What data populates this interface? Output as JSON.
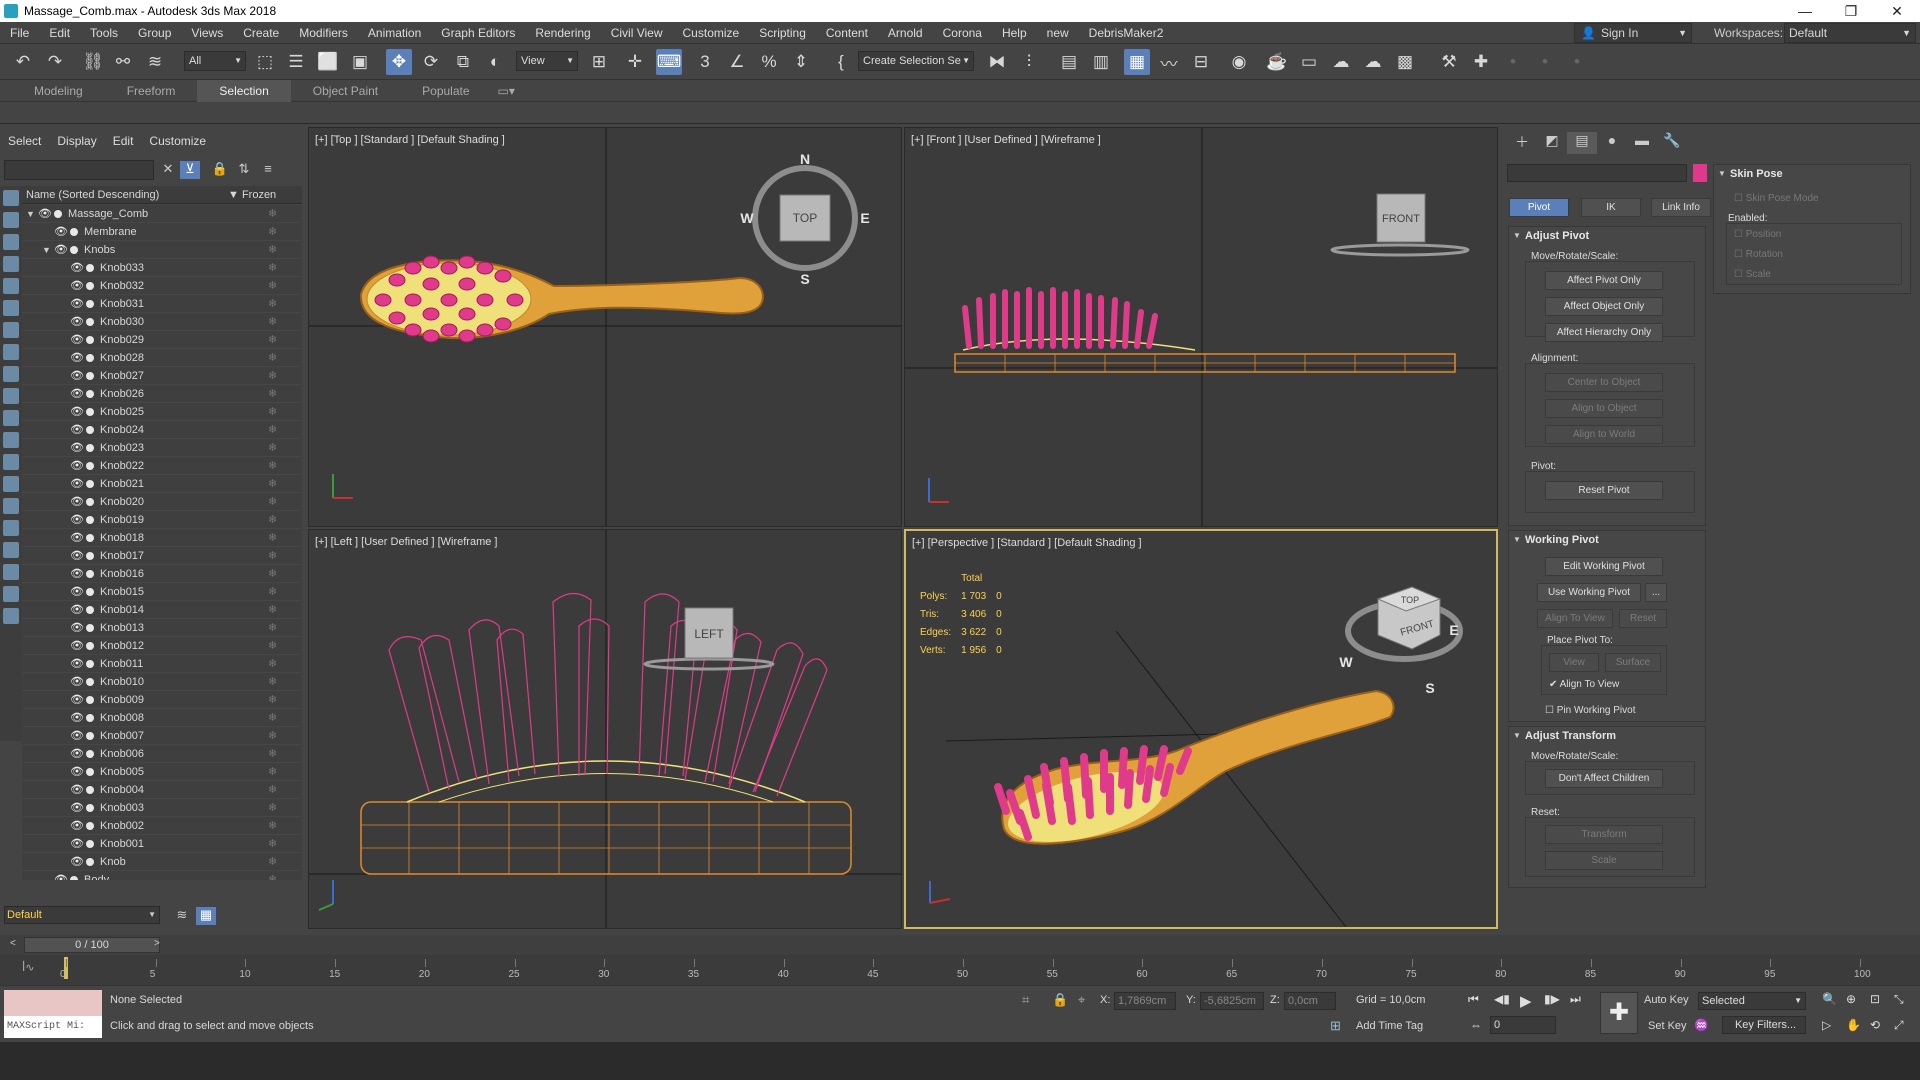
{
  "window": {
    "title": "Massage_Comb.max - Autodesk 3ds Max 2018",
    "minimize": "—",
    "maximize": "❐",
    "close": "✕"
  },
  "menu": [
    "File",
    "Edit",
    "Tools",
    "Group",
    "Views",
    "Create",
    "Modifiers",
    "Animation",
    "Graph Editors",
    "Rendering",
    "Civil View",
    "Customize",
    "Scripting",
    "Content",
    "Arnold",
    "Corona",
    "Help",
    "new",
    "DebrisMaker2"
  ],
  "signin": "Sign In",
  "workspace": {
    "label": "Workspaces:",
    "value": "Default"
  },
  "toolbar": {
    "filter": "All",
    "ref_coord": "View",
    "selection_set": "Create Selection Se"
  },
  "ribbon": {
    "tabs": [
      "Modeling",
      "Freeform",
      "Selection",
      "Object Paint",
      "Populate"
    ],
    "active": "Selection"
  },
  "explorer": {
    "menu": [
      "Select",
      "Display",
      "Edit",
      "Customize"
    ],
    "col_name": "Name (Sorted Descending)",
    "col_frozen": "▼ Frozen",
    "layer": "Default",
    "items": [
      {
        "name": "Massage_Comb",
        "level": 0,
        "toggle": "▼"
      },
      {
        "name": "Membrane",
        "level": 1,
        "toggle": ""
      },
      {
        "name": "Knobs",
        "level": 1,
        "toggle": "▼"
      },
      {
        "name": "Knob033",
        "level": 2,
        "toggle": ""
      },
      {
        "name": "Knob032",
        "level": 2,
        "toggle": ""
      },
      {
        "name": "Knob031",
        "level": 2,
        "toggle": ""
      },
      {
        "name": "Knob030",
        "level": 2,
        "toggle": ""
      },
      {
        "name": "Knob029",
        "level": 2,
        "toggle": ""
      },
      {
        "name": "Knob028",
        "level": 2,
        "toggle": ""
      },
      {
        "name": "Knob027",
        "level": 2,
        "toggle": ""
      },
      {
        "name": "Knob026",
        "level": 2,
        "toggle": ""
      },
      {
        "name": "Knob025",
        "level": 2,
        "toggle": ""
      },
      {
        "name": "Knob024",
        "level": 2,
        "toggle": ""
      },
      {
        "name": "Knob023",
        "level": 2,
        "toggle": ""
      },
      {
        "name": "Knob022",
        "level": 2,
        "toggle": ""
      },
      {
        "name": "Knob021",
        "level": 2,
        "toggle": ""
      },
      {
        "name": "Knob020",
        "level": 2,
        "toggle": ""
      },
      {
        "name": "Knob019",
        "level": 2,
        "toggle": ""
      },
      {
        "name": "Knob018",
        "level": 2,
        "toggle": ""
      },
      {
        "name": "Knob017",
        "level": 2,
        "toggle": ""
      },
      {
        "name": "Knob016",
        "level": 2,
        "toggle": ""
      },
      {
        "name": "Knob015",
        "level": 2,
        "toggle": ""
      },
      {
        "name": "Knob014",
        "level": 2,
        "toggle": ""
      },
      {
        "name": "Knob013",
        "level": 2,
        "toggle": ""
      },
      {
        "name": "Knob012",
        "level": 2,
        "toggle": ""
      },
      {
        "name": "Knob011",
        "level": 2,
        "toggle": ""
      },
      {
        "name": "Knob010",
        "level": 2,
        "toggle": ""
      },
      {
        "name": "Knob009",
        "level": 2,
        "toggle": ""
      },
      {
        "name": "Knob008",
        "level": 2,
        "toggle": ""
      },
      {
        "name": "Knob007",
        "level": 2,
        "toggle": ""
      },
      {
        "name": "Knob006",
        "level": 2,
        "toggle": ""
      },
      {
        "name": "Knob005",
        "level": 2,
        "toggle": ""
      },
      {
        "name": "Knob004",
        "level": 2,
        "toggle": ""
      },
      {
        "name": "Knob003",
        "level": 2,
        "toggle": ""
      },
      {
        "name": "Knob002",
        "level": 2,
        "toggle": ""
      },
      {
        "name": "Knob001",
        "level": 2,
        "toggle": ""
      },
      {
        "name": "Knob",
        "level": 2,
        "toggle": ""
      },
      {
        "name": "Body",
        "level": 1,
        "toggle": ""
      }
    ]
  },
  "viewports": {
    "top": {
      "label": "[+] [Top ] [Standard ] [Default Shading ]",
      "cube": "TOP",
      "compass": {
        "n": "N",
        "s": "S",
        "e": "E",
        "w": "W"
      }
    },
    "front": {
      "label": "[+] [Front ] [User Defined ] [Wireframe ]",
      "cube": "FRONT"
    },
    "left": {
      "label": "[+] [Left ] [User Defined ] [Wireframe ]",
      "cube": "LEFT"
    },
    "perspective": {
      "label": "[+] [Perspective ] [Standard ] [Default Shading ]",
      "cube_top": "TOP",
      "cube_front": "FRONT",
      "compass": {
        "w": "W",
        "s": "S",
        "e": "E"
      },
      "stats": {
        "header": "Total",
        "rows": [
          {
            "k": "Polys:",
            "v": "1 703",
            "s": "0"
          },
          {
            "k": "Tris:",
            "v": "3 406",
            "s": "0"
          },
          {
            "k": "Edges:",
            "v": "3 622",
            "s": "0"
          },
          {
            "k": "Verts:",
            "v": "1 956",
            "s": "0"
          }
        ]
      }
    }
  },
  "command_panel": {
    "tabs_icons": [
      "plus-icon",
      "modify-icon",
      "hierarchy-icon",
      "motion-icon",
      "display-icon",
      "utilities-icon"
    ],
    "color_swatch": "#e0388a",
    "hier_buttons": [
      "Pivot",
      "IK",
      "Link Info"
    ],
    "adjust_pivot": {
      "title": "Adjust Pivot",
      "move_label": "Move/Rotate/Scale:",
      "buttons": [
        "Affect Pivot Only",
        "Affect Object Only",
        "Affect Hierarchy Only"
      ],
      "alignment_label": "Alignment:",
      "align_buttons": [
        "Center to Object",
        "Align to Object",
        "Align to World"
      ],
      "pivot_label": "Pivot:",
      "reset_pivot": "Reset Pivot"
    },
    "working_pivot": {
      "title": "Working Pivot",
      "edit": "Edit Working Pivot",
      "use": "Use Working Pivot",
      "dots": "...",
      "align_to_view": "Align To View",
      "reset": "Reset",
      "place_label": "Place Pivot To:",
      "view": "View",
      "surface": "Surface",
      "align_check": "Align To View",
      "pin": "Pin Working Pivot"
    },
    "adjust_transform": {
      "title": "Adjust Transform",
      "move_label": "Move/Rotate/Scale:",
      "dont_affect": "Don't Affect Children",
      "reset_label": "Reset:",
      "transform": "Transform",
      "scale": "Scale"
    },
    "skin_pose": {
      "title": "Skin Pose",
      "mode": "Skin Pose Mode",
      "enabled": "Enabled:",
      "position": "Position",
      "rotation": "Rotation",
      "scale": "Scale"
    }
  },
  "timeline": {
    "frame": "0 / 100",
    "ticks": [
      "0",
      "5",
      "10",
      "15",
      "20",
      "25",
      "30",
      "35",
      "40",
      "45",
      "50",
      "55",
      "60",
      "65",
      "70",
      "75",
      "80",
      "85",
      "90",
      "95",
      "100"
    ]
  },
  "status": {
    "maxscript": "MAXScript Mi:",
    "selection": "None Selected",
    "prompt": "Click and drag to select and move objects",
    "x_label": "X:",
    "x": "1,7869cm",
    "y_label": "Y:",
    "y": "-5,6825cm",
    "z_label": "Z:",
    "z": "0,0cm",
    "grid": "Grid = 10,0cm",
    "add_time_tag": "Add Time Tag",
    "auto_key": "Auto Key",
    "set_key": "Set Key",
    "selected": "Selected",
    "key_filters": "Key Filters...",
    "frame_field": "0"
  }
}
